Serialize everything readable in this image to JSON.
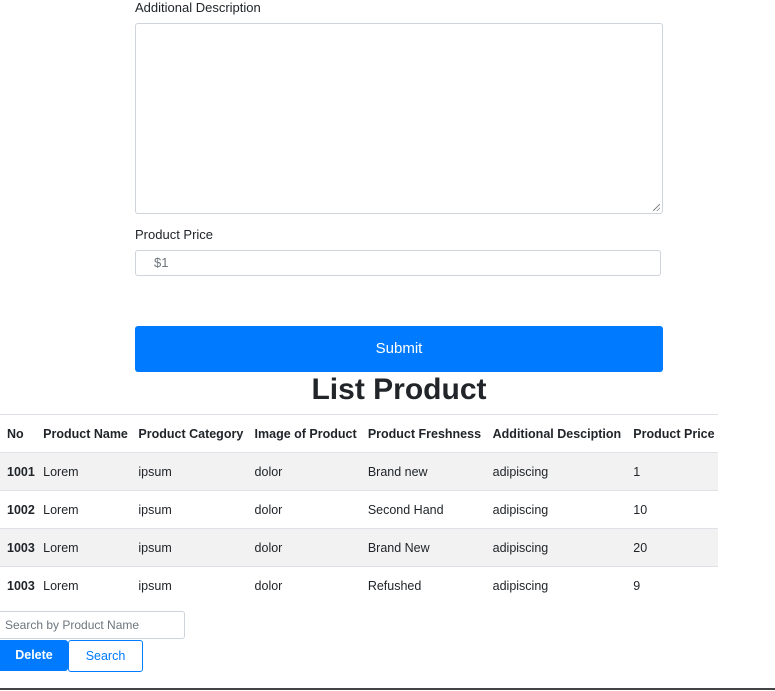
{
  "form": {
    "description_label": "Additional Description",
    "description_value": "",
    "price_label": "Product Price",
    "price_placeholder": "$1",
    "submit_label": "Submit"
  },
  "list": {
    "title": "List Product",
    "columns": [
      "No",
      "Product Name",
      "Product Category",
      "Image of Product",
      "Product Freshness",
      "Additional Desciption",
      "Product Price"
    ],
    "rows": [
      [
        "1001",
        "Lorem",
        "ipsum",
        "dolor",
        "Brand new",
        "adipiscing",
        "1"
      ],
      [
        "1002",
        "Lorem",
        "ipsum",
        "dolor",
        "Second Hand",
        "adipiscing",
        "10"
      ],
      [
        "1003",
        "Lorem",
        "ipsum",
        "dolor",
        "Brand New",
        "adipiscing",
        "20"
      ],
      [
        "1003",
        "Lorem",
        "ipsum",
        "dolor",
        "Refushed",
        "adipiscing",
        "9"
      ]
    ]
  },
  "actions": {
    "search_placeholder": "Search by Product Name",
    "delete_label": "Delete",
    "search_label": "Search"
  },
  "colors": {
    "primary": "#007bff",
    "stripe": "#f2f2f2",
    "border": "#ced4da"
  }
}
